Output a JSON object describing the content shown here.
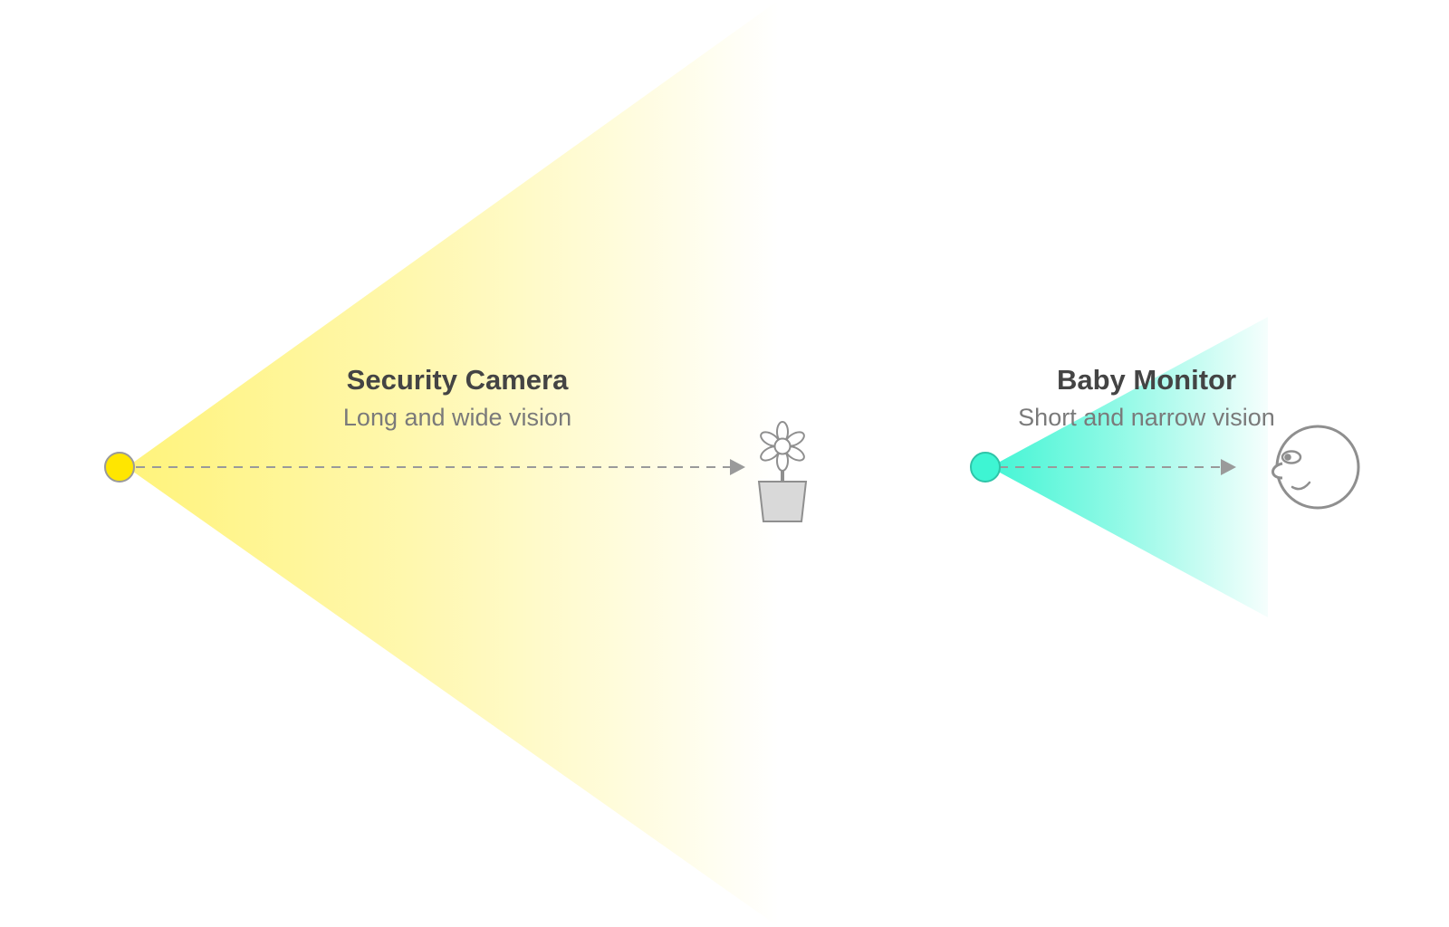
{
  "cameras": [
    {
      "id": "security-camera",
      "title": "Security Camera",
      "subtitle": "Long and wide vision",
      "color": "#ffe600",
      "cone_color": "#fff37a",
      "target": "flower-pot-icon"
    },
    {
      "id": "baby-monitor",
      "title": "Baby Monitor",
      "subtitle": "Short and narrow vision",
      "color": "#3ef5d3",
      "cone_color": "#3ef5d3",
      "target": "baby-face-icon"
    }
  ],
  "colors": {
    "line": "#9a9a9a",
    "icon_stroke": "#8f8f8f",
    "icon_fill": "#d9d9d9"
  }
}
